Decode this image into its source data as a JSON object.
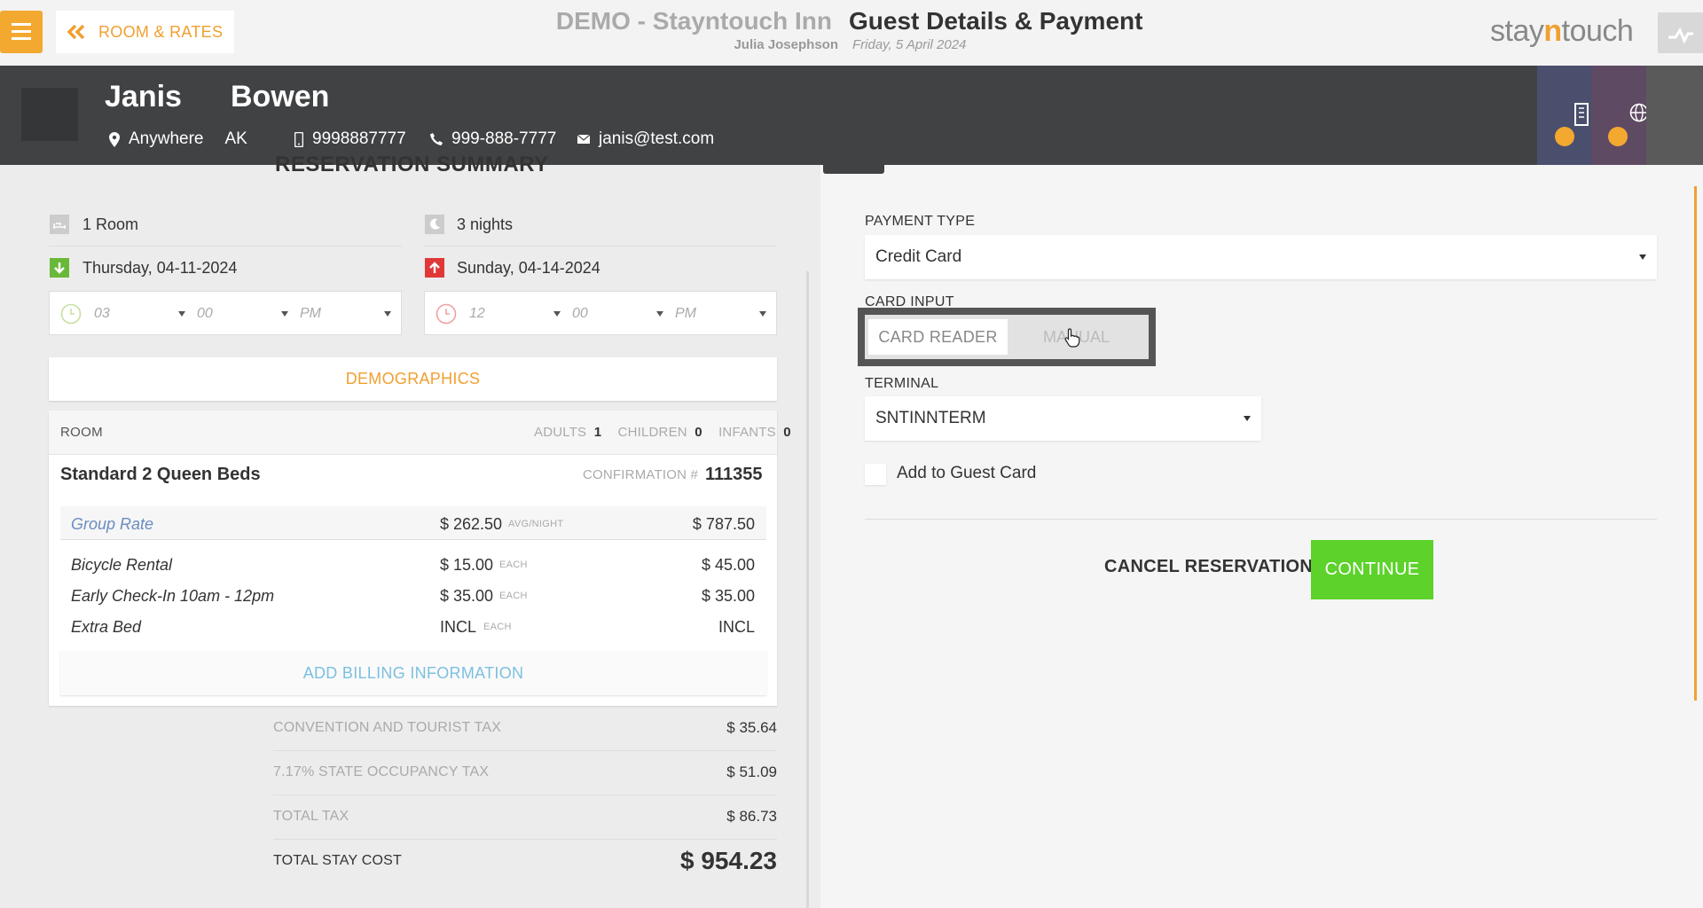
{
  "topbar": {
    "back_label": "ROOM & RATES",
    "hotel_name": "DEMO - Stayntouch Inn",
    "user_name": "Julia Josephson",
    "page_title": "Guest Details & Payment",
    "business_date": "Friday, 5 April 2024",
    "logo_prefix": "stay",
    "logo_accent": "n",
    "logo_suffix": "touch"
  },
  "guest": {
    "first_name": "Janis",
    "last_name": "Bowen",
    "city": "Anywhere",
    "state": "AK",
    "mobile": "9998887777",
    "phone": "999-888-7777",
    "email": "janis@test.com"
  },
  "summary": {
    "heading": "RESERVATION SUMMARY",
    "rooms": "1 Room",
    "nights": "3 nights",
    "arrival_date": "Thursday, 04-11-2024",
    "departure_date": "Sunday, 04-14-2024",
    "arrival_time": {
      "hour": "03",
      "minute": "00",
      "ampm": "PM"
    },
    "departure_time": {
      "hour": "12",
      "minute": "00",
      "ampm": "PM"
    },
    "demographics_label": "DEMOGRAPHICS"
  },
  "room": {
    "header_label": "ROOM",
    "adults_label": "ADULTS",
    "adults": "1",
    "children_label": "CHILDREN",
    "children": "0",
    "infants_label": "INFANTS",
    "infants": "0",
    "room_type": "Standard 2 Queen Beds",
    "confirmation_label": "CONFIRMATION #",
    "confirmation_number": "111355",
    "rate_name": "Group Rate",
    "rate_avg": "$ 262.50",
    "rate_avg_label": "AVG/NIGHT",
    "rate_total": "$ 787.50",
    "addons": [
      {
        "name": "Bicycle Rental",
        "price": "$ 15.00",
        "unit": "EACH",
        "total": "$ 45.00"
      },
      {
        "name": "Early Check-In 10am - 12pm",
        "price": "$ 35.00",
        "unit": "EACH",
        "total": "$ 35.00"
      },
      {
        "name": "Extra Bed",
        "price": "INCL",
        "unit": "EACH",
        "total": "INCL"
      }
    ],
    "add_billing_label": "ADD BILLING INFORMATION"
  },
  "taxes": {
    "convention_label": "CONVENTION AND TOURIST TAX",
    "convention_value": "$ 35.64",
    "state_label": "7.17% STATE OCCUPANCY TAX",
    "state_value": "$ 51.09",
    "total_tax_label": "TOTAL TAX",
    "total_tax_value": "$ 86.73",
    "total_stay_label": "TOTAL STAY COST",
    "total_stay_value": "$ 954.23"
  },
  "payment": {
    "payment_type_label": "PAYMENT TYPE",
    "payment_type_value": "Credit Card",
    "card_input_label": "CARD INPUT",
    "card_reader_label": "CARD READER",
    "manual_label": "MANUAL",
    "terminal_label": "TERMINAL",
    "terminal_value": "SNTINNTERM",
    "add_to_guest_card_label": "Add to Guest Card",
    "cancel_label": "CANCEL RESERVATION",
    "continue_label": "CONTINUE"
  },
  "colors": {
    "accent": "#f0a030",
    "continue": "#5cd22a",
    "header_bg": "#414244",
    "arrival": "#6ab83a",
    "departure": "#e03838",
    "side_tab_1": "#4a4f6e",
    "side_tab_2": "#5e4a62",
    "side_tab_3": "#5a5a5a"
  },
  "icons": [
    "menu-icon",
    "double-chevron-left-icon",
    "activity-icon",
    "location-pin-icon",
    "mobile-icon",
    "phone-icon",
    "mail-icon",
    "bed-icon",
    "moon-icon",
    "arrival-arrow-icon",
    "departure-arrow-icon",
    "clock-icon",
    "building-icon",
    "globe-icon",
    "search-icon"
  ]
}
